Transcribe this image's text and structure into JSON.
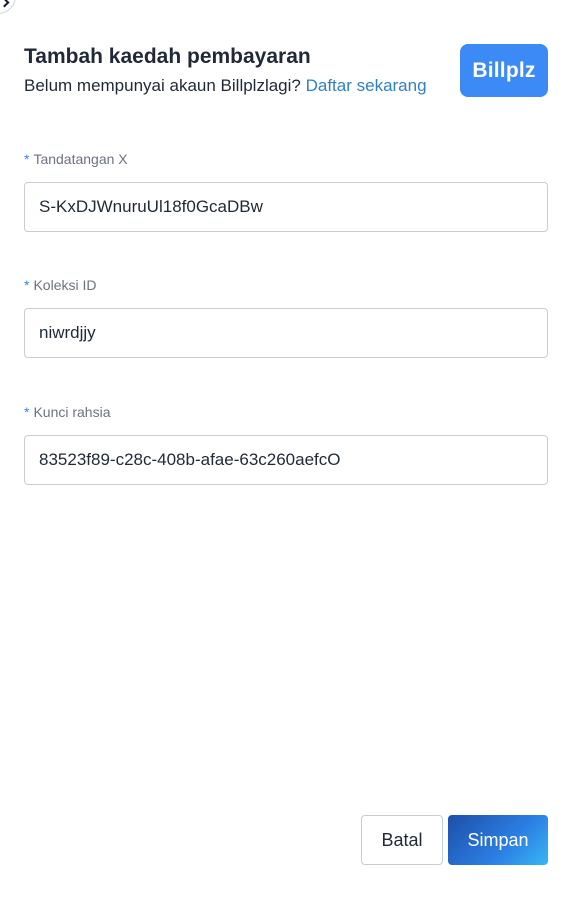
{
  "header": {
    "title": "Tambah kaedah pembayaran",
    "subtitle_text": "Belum mempunyai akaun Billplzlagi? ",
    "signup_link": "Daftar sekarang",
    "logo_text": "Billplz"
  },
  "form": {
    "fields": [
      {
        "required_mark": "*",
        "label": "Tandatangan X",
        "value": "S-KxDJWnuruUl18f0GcaDBw"
      },
      {
        "required_mark": "*",
        "label": "Koleksi ID",
        "value": "niwrdjjy"
      },
      {
        "required_mark": "*",
        "label": "Kunci rahsia",
        "value": "83523f89-c28c-408b-afae-63c260aefcO"
      }
    ]
  },
  "footer": {
    "cancel_label": "Batal",
    "save_label": "Simpan"
  },
  "colors": {
    "accent": "#3b8af5",
    "link": "#2f80c4",
    "required": "#3b82f6"
  },
  "icons": {
    "back": "chevron-right-icon"
  }
}
